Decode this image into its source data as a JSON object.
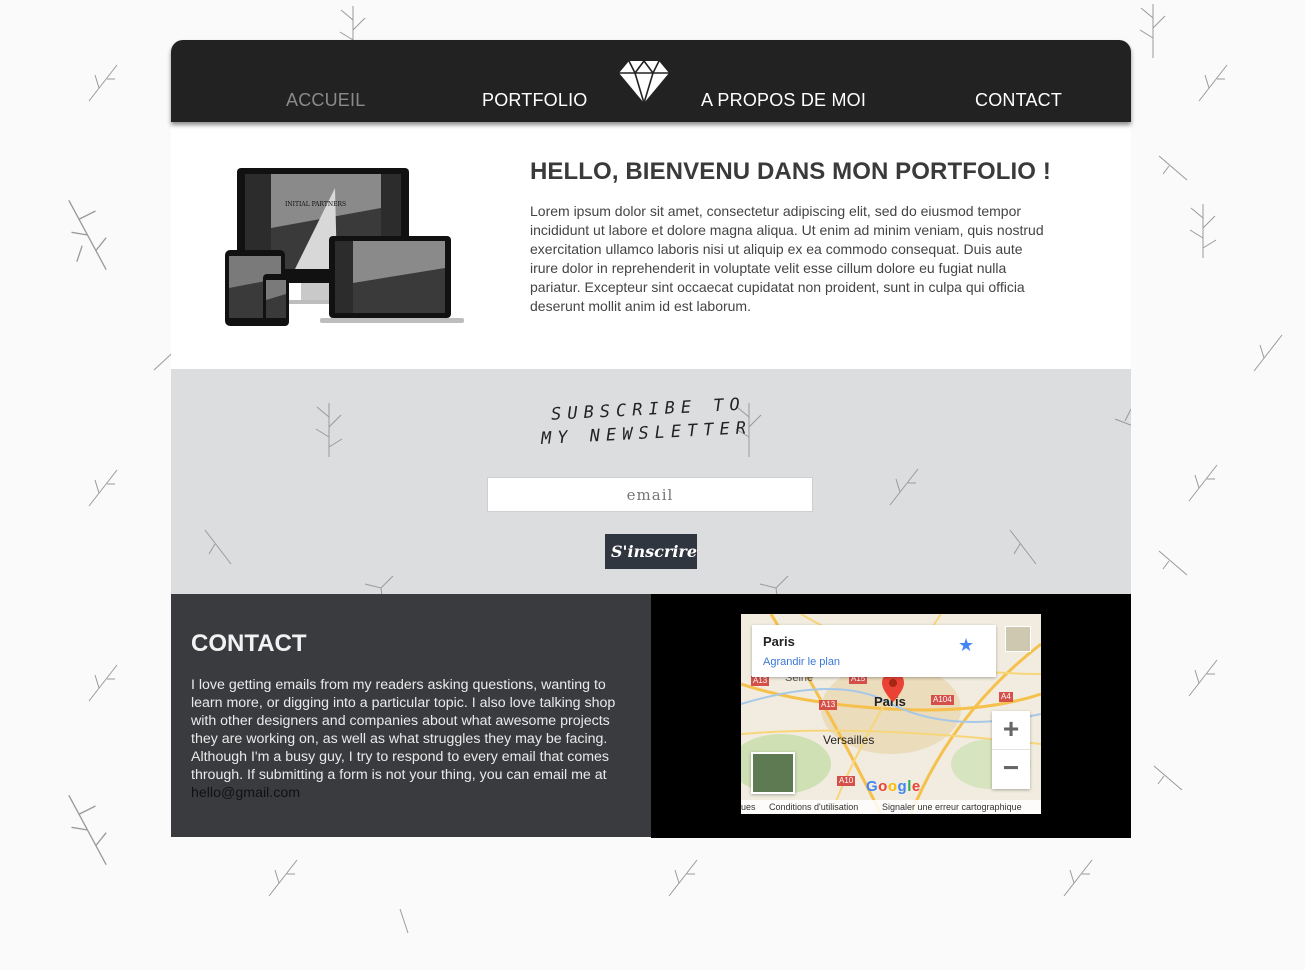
{
  "nav": {
    "items": [
      {
        "label": "ACCUEIL",
        "active": true
      },
      {
        "label": "PORTFOLIO",
        "active": false
      },
      {
        "label": "A PROPOS DE MOI",
        "active": false
      },
      {
        "label": "CONTACT",
        "active": false
      }
    ],
    "logo_icon": "diamond-icon"
  },
  "hero": {
    "title": "HELLO, BIENVENU DANS MON PORTFOLIO !",
    "text": "Lorem ipsum dolor sit amet, consectetur adipiscing elit, sed do eiusmod tempor incididunt ut labore et dolore magna aliqua. Ut enim ad minim veniam, quis nostrud exercitation ullamco laboris nisi ut aliquip ex ea commodo consequat. Duis aute irure dolor in reprehenderit in voluptate velit esse cillum dolore eu fugiat nulla pariatur. Excepteur sint occaecat cupidatat non proident, sunt in culpa qui officia deserunt mollit anim id est laborum.",
    "devices_caption": "INITIAL PARTNERS"
  },
  "newsletter": {
    "title_line1": "SUBSCRIBE TO",
    "title_line2": "MY NEWSLETTER",
    "email_placeholder": "email",
    "button_label": "S'inscrire"
  },
  "contact": {
    "title": "CONTACT",
    "text": "I love getting emails from my readers asking questions, wanting to learn more, or digging into a particular topic. I also love talking shop with other designers and companies about what awesome projects they are working on, as well as what struggles they may be facing. Although I'm a busy guy, I try to respond to every email that comes through. If submitting a form is not your thing, you can email me at",
    "email": "hello@gmail.com"
  },
  "map": {
    "place": "Paris",
    "enlarge_link": "Agrandir le plan",
    "labels": {
      "paris": "Paris",
      "versailles": "Versailles",
      "seine": "Seine"
    },
    "roads": [
      "A13",
      "A15",
      "A13",
      "A104",
      "A4",
      "A10"
    ],
    "zoom_in": "+",
    "zoom_out": "−",
    "google": "Google",
    "footer": {
      "left": "ues",
      "terms": "Conditions d'utilisation",
      "report": "Signaler une erreur cartographique"
    }
  },
  "colors": {
    "nav_bg": "#222222",
    "nav_active": "#8a8a8a",
    "newsletter_bg": "#dcdddf",
    "contact_bg": "#3a3b3f",
    "button_bg": "#2f3640",
    "map_link": "#3a78d6"
  }
}
